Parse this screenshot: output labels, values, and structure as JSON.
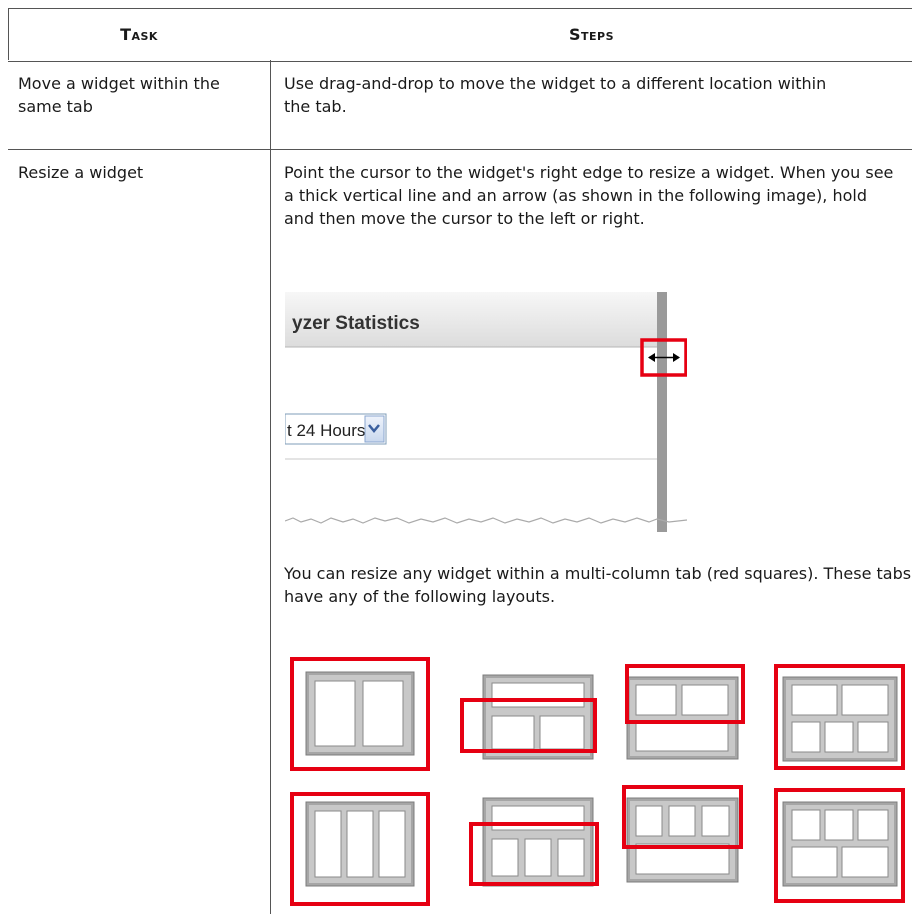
{
  "table": {
    "headers": [
      "Task",
      "Steps"
    ],
    "rows": [
      {
        "task": "Move a widget within the same tab",
        "steps": [
          "Use drag-and-drop to move the widget to a different location within the tab."
        ]
      },
      {
        "task": "Resize a widget",
        "steps": [
          "Point the cursor to the widget's right edge to resize a widget. When you see a thick vertical line and an arrow (as shown in the following image), hold and then move the cursor to the left or right.",
          "You can resize any widget within a multi-column tab (red squares). These tabs have any of the following layouts."
        ]
      }
    ]
  },
  "screenshot": {
    "widget_title": "yzer Statistics",
    "dropdown_value": "t 24 Hours"
  },
  "colors": {
    "highlight_red": "#e60012",
    "border": "#555555"
  }
}
